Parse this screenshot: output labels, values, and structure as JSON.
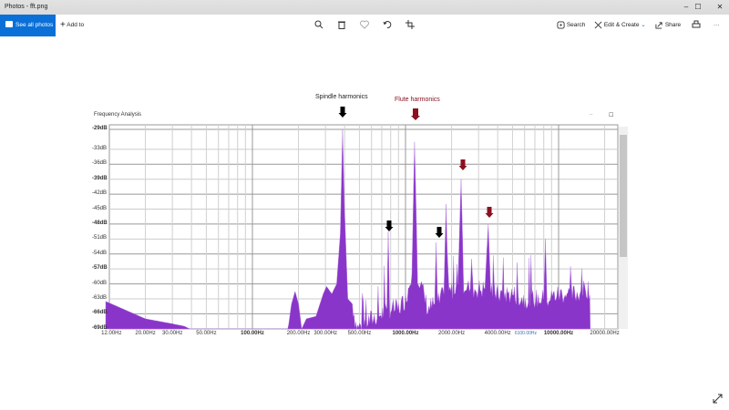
{
  "window": {
    "title": "Photos - fft.png",
    "minimize": "–",
    "maximize": "☐",
    "close": "✕"
  },
  "toolbar": {
    "see_all_photos": "See all photos",
    "add_to": "Add to",
    "search": "Search",
    "edit_create": "Edit & Create",
    "share": "Share",
    "more": "···"
  },
  "image": {
    "frame_title": "Frequency Analysis",
    "frame_min": "–",
    "frame_max": "☐",
    "annotations": {
      "spindle": "Spindle harmonics",
      "flute": "Flute harmonics"
    },
    "colors": {
      "fill": "#8a35c9",
      "flute_arrow": "#8b1020",
      "spindle_arrow": "#000000",
      "accent": "#0a70d8"
    },
    "chart_data": {
      "type": "area",
      "title": "Frequency Analysis",
      "xscale": "log",
      "xlim": [
        10,
        22000
      ],
      "ylim": [
        -69,
        -29
      ],
      "y_ticks": [
        "-29dB",
        "-33dB",
        "-36dB",
        "-39dB",
        "-42dB",
        "-45dB",
        "-48dB",
        "-51dB",
        "-54dB",
        "-57dB",
        "-60dB",
        "-63dB",
        "-66dB",
        "-69dB"
      ],
      "y_tick_values": [
        -29,
        -33,
        -36,
        -39,
        -42,
        -45,
        -48,
        -51,
        -54,
        -57,
        -60,
        -63,
        -66,
        -69
      ],
      "x_ticks": [
        {
          "label": "12.00Hz",
          "f": 12
        },
        {
          "label": "20.00Hz",
          "f": 20
        },
        {
          "label": "30.00Hz",
          "f": 30
        },
        {
          "label": "50.00Hz",
          "f": 50
        },
        {
          "label": "100.00Hz",
          "f": 100,
          "bold": true
        },
        {
          "label": "200.00Hz",
          "f": 200
        },
        {
          "label": "300.00Hz",
          "f": 300
        },
        {
          "label": "500.00Hz",
          "f": 500
        },
        {
          "label": "1000.00Hz",
          "f": 1000,
          "bold": true
        },
        {
          "label": "2000.00Hz",
          "f": 2000
        },
        {
          "label": "4000.00Hz",
          "f": 4000
        },
        {
          "label": "6100.00Hz",
          "f": 6100
        },
        {
          "label": "10000.00Hz",
          "f": 10000,
          "bold": true
        },
        {
          "label": "20000.00Hz",
          "f": 20000
        }
      ],
      "spectrum": [
        [
          11,
          -63.5
        ],
        [
          20,
          -67
        ],
        [
          30,
          -68
        ],
        [
          36,
          -68.5
        ],
        [
          42,
          -69.5
        ],
        [
          170,
          -69.5
        ],
        [
          180,
          -64
        ],
        [
          190,
          -61.5
        ],
        [
          200,
          -64
        ],
        [
          210,
          -69
        ],
        [
          225,
          -67
        ],
        [
          260,
          -66.5
        ],
        [
          290,
          -62
        ],
        [
          305,
          -60.5
        ],
        [
          330,
          -62
        ],
        [
          355,
          -60
        ],
        [
          375,
          -50
        ],
        [
          388,
          -29
        ],
        [
          400,
          -45
        ],
        [
          420,
          -63
        ],
        [
          450,
          -64
        ],
        [
          480,
          -69
        ],
        [
          530,
          -68
        ],
        [
          600,
          -67
        ],
        [
          700,
          -66
        ],
        [
          755,
          -65
        ],
        [
          771,
          -49.5
        ],
        [
          790,
          -65
        ],
        [
          900,
          -65
        ],
        [
          1000,
          -63
        ],
        [
          1100,
          -58
        ],
        [
          1146,
          -31.5
        ],
        [
          1200,
          -58
        ],
        [
          1400,
          -65
        ],
        [
          1550,
          -64
        ],
        [
          1585,
          -51.7
        ],
        [
          1620,
          -64
        ],
        [
          1780,
          -62
        ],
        [
          1840,
          -44
        ],
        [
          1900,
          -62
        ],
        [
          2200,
          -60
        ],
        [
          2307,
          -39
        ],
        [
          2400,
          -60
        ],
        [
          2650,
          -61
        ],
        [
          2700,
          -55
        ],
        [
          2750,
          -61
        ],
        [
          3300,
          -61
        ],
        [
          3470,
          -48
        ],
        [
          3600,
          -61
        ],
        [
          4000,
          -62
        ],
        [
          5000,
          -62
        ],
        [
          6000,
          -63
        ],
        [
          8000,
          -63
        ],
        [
          8200,
          -51
        ],
        [
          8400,
          -63
        ],
        [
          10000,
          -62
        ],
        [
          13000,
          -62
        ],
        [
          15000,
          -61
        ],
        [
          16000,
          -61
        ],
        [
          16100,
          -69.5
        ]
      ],
      "peaks": [
        {
          "f": 388,
          "db": -29,
          "group": "spindle"
        },
        {
          "f": 771,
          "db": -49.5,
          "group": "spindle"
        },
        {
          "f": 1585,
          "db": -51.7,
          "group": "spindle"
        },
        {
          "f": 1146,
          "db": -31.5,
          "group": "flute"
        },
        {
          "f": 2307,
          "db": -39,
          "group": "flute"
        },
        {
          "f": 3470,
          "db": -48,
          "group": "flute"
        }
      ]
    }
  }
}
